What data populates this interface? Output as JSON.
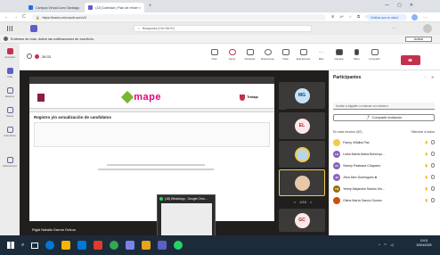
{
  "browser": {
    "tabs": [
      {
        "label": "Campus Virtual Liceo Santiago",
        "color": "#1a73e8"
      },
      {
        "label": "(13) Calendar | Plan de refuer ×",
        "color": "#5b5fc7",
        "active": true
      }
    ],
    "new_tab": "+",
    "url": "https://teams.microsoft.com/v2/",
    "verify_label": "Verificar que es usted",
    "nav": {
      "back": "←",
      "forward": "→",
      "reload": "C"
    }
  },
  "teams": {
    "search_placeholder": "Búsqueda (Ctrl+Alt+E)",
    "more": "···",
    "notification": "Entérese de todo. Active las notificaciones de escritorio.",
    "activate_label": "Activar"
  },
  "rail": [
    {
      "label": "Actividad",
      "color": "#c4314b"
    },
    {
      "label": "Chat",
      "color": "#5b5fc7"
    },
    {
      "label": "Equipos",
      "color": "#6264a7"
    },
    {
      "label": "Tareas",
      "color": "#6264a7"
    },
    {
      "label": "Calendario",
      "color": "#6264a7"
    },
    {
      "label": "Llamadas",
      "color": "#6264a7"
    },
    {
      "label": "Aplicaciones",
      "color": "#6264a7"
    }
  ],
  "meeting": {
    "timer": "38:33",
    "toolbar": [
      {
        "label": "Chat",
        "icon": "chat-icon"
      },
      {
        "label": "Gente",
        "icon": "people-icon"
      },
      {
        "label": "Participar",
        "icon": "raise-hand-icon"
      },
      {
        "label": "Reacciones",
        "icon": "smile-icon"
      },
      {
        "label": "Vista",
        "icon": "grid-icon"
      },
      {
        "label": "Aplicaciones",
        "icon": "apps-icon"
      },
      {
        "label": "Más",
        "icon": "more-icon"
      },
      {
        "label": "Cámara",
        "icon": "camera-icon"
      },
      {
        "label": "Micro",
        "icon": "mic-icon"
      },
      {
        "label": "Compartir",
        "icon": "share-icon"
      }
    ],
    "hangup": "Salir"
  },
  "shared": {
    "logo": "mape",
    "logo_tag": "Trabajo",
    "title": "Registro y/o actualización de candidatos",
    "presenter": "Rigid Natalia García Ochoa"
  },
  "tiles": [
    {
      "initials": "MG",
      "bg": "#c7e0f4",
      "fg": "#004578"
    },
    {
      "initials": "EL",
      "bg": "#fde7e9",
      "fg": "#a4262c"
    },
    {
      "initials": "",
      "bg": "#dff6dd",
      "fg": "#107c10",
      "photo": true
    },
    {
      "initials": "",
      "bg": "#f4e8d0",
      "fg": "#8a6200",
      "photo": true
    },
    {
      "initials": "GC",
      "bg": "#fde7e9",
      "fg": "#a4262c"
    }
  ],
  "pager": {
    "text": "1/16",
    "prev": "<",
    "next": ">"
  },
  "participants": {
    "title": "Participantes",
    "invite_placeholder": "Invitar a alguien o marcar un número",
    "share_label": "Compartir invitación",
    "section": "En esta reunión (82)",
    "mute_all": "Silenciar a todos",
    "people": [
      {
        "name": "Fanny Villalba Paz",
        "initials": "FV",
        "color": "#8764b8"
      },
      {
        "name": "Luisa María Arana Bohorqu...",
        "initials": "LB",
        "color": "#5c2e91"
      },
      {
        "name": "Vianey Pastrana Chaparro",
        "initials": "VC",
        "color": "#0078d4"
      },
      {
        "name": "Jhon Alex Dominguez ♣",
        "initials": "JD",
        "color": "#8764b8"
      },
      {
        "name": "Yeimy Alejandra Santos Mo...",
        "initials": "YM",
        "color": "#986f0b"
      },
      {
        "name": "Gilma María García Gomez",
        "initials": "GG",
        "color": "#ca5010"
      }
    ]
  },
  "whatsapp": {
    "title": "(18) WhatsApp - Google Chro..."
  },
  "taskbar": {
    "time": "10:01",
    "date": "20/04/2025",
    "apps": [
      "#0078d4",
      "#f4b400",
      "#0078d4",
      "#e23b2a",
      "#34a853",
      "#7b83eb",
      "#e8a317",
      "#5b5fc7",
      "#25d366"
    ]
  }
}
